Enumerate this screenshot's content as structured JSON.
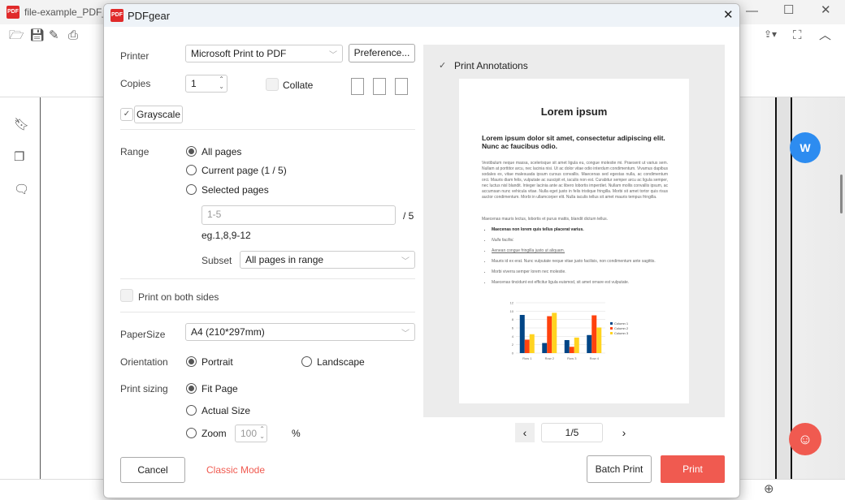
{
  "app": {
    "title": "file-example_PDF_",
    "window_controls": [
      "minimize",
      "maximize",
      "close"
    ]
  },
  "dialog": {
    "title": "PDFgear",
    "printer": {
      "label": "Printer",
      "value": "Microsoft Print to PDF",
      "preferences_label": "Preference..."
    },
    "copies": {
      "label": "Copies",
      "value": "1",
      "collate_label": "Collate",
      "collate_checked": false
    },
    "grayscale": {
      "label": "Grayscale",
      "checked": true
    },
    "range": {
      "label": "Range",
      "options": [
        "All pages",
        "Current page (1 / 5)",
        "Selected pages"
      ],
      "selected": 0,
      "pages_value": "1-5",
      "total": "/ 5",
      "hint": "eg.1,8,9-12",
      "subset_label": "Subset",
      "subset_value": "All pages in range"
    },
    "both_sides": {
      "label": "Print on both sides",
      "checked": false
    },
    "paper": {
      "label": "PaperSize",
      "value": "A4 (210*297mm)"
    },
    "orientation": {
      "label": "Orientation",
      "options": [
        "Portrait",
        "Landscape"
      ],
      "selected": 0
    },
    "sizing": {
      "label": "Print sizing",
      "options": [
        "Fit Page",
        "Actual Size",
        "Zoom"
      ],
      "selected": 0,
      "zoom_value": "100",
      "zoom_unit": "%"
    },
    "buttons": {
      "cancel": "Cancel",
      "classic": "Classic Mode",
      "batch": "Batch Print",
      "print": "Print"
    },
    "preview": {
      "annotations_label": "Print Annotations",
      "annotations_checked": true,
      "page_indicator": "1/5",
      "doc": {
        "title": "Lorem ipsum",
        "subtitle": "Lorem ipsum dolor sit amet, consectetur adipiscing elit. Nunc ac faucibus odio.",
        "para1": "Vestibulum neque massa, scelerisque sit amet ligula eu, congue molestie mi. Praesent ut varius sem. Nullam at porttitor arcu, nec lacinia nisi. Ut ac dolor vitae odio interdum condimentum. Vivamus dapibus sodales ex, vitae malesuada ipsum cursus convallis. Maecenas sed egestas nulla, ac condimentum orci. Mauris diam felis, vulputate ac suscipit et, iaculis non est. Curabitur semper arcu ac ligula semper, nec luctus nisl blandit. Integer lacinia ante ac libero lobortis imperdiet. Nullam mollis convallis ipsum, ac accumsan nunc vehicula vitae. Nulla eget justo in felis tristique fringilla. Morbi sit amet tortor quis risus auctor condimentum. Morbi in ullamcorper elit. Nulla iaculis tellus sit amet mauris tempus fringilla.",
        "para2": "Maecenas mauris lectus, lobortis et purus mattis, blandit dictum tellus.",
        "bullets": [
          "Maecenas non lorem quis tellus placerat varius.",
          "Nulla facilisi.",
          "Aenean congue fringilla justo ut aliquam.",
          "Mauris id ex erat. Nunc vulputate neque vitae justo facilisis, non condimentum ante sagittis.",
          "Morbi viverra semper lorem nec molestie.",
          "Maecenas tincidunt est efficitur ligula euismod, sit amet ornare est vulputate."
        ],
        "chart": {
          "type": "bar",
          "categories": [
            "Row 1",
            "Row 2",
            "Row 3",
            "Row 4"
          ],
          "ylim": [
            0,
            12
          ],
          "yticks": [
            "0",
            "2",
            "4",
            "6",
            "8",
            "10",
            "12"
          ],
          "series": [
            {
              "name": "Column 1",
              "color": "#004586",
              "values": [
                9.1,
                2.4,
                3.1,
                4.3
              ]
            },
            {
              "name": "Column 2",
              "color": "#ff420e",
              "values": [
                3.2,
                8.8,
                1.5,
                9
              ]
            },
            {
              "name": "Column 3",
              "color": "#ffd320",
              "values": [
                4.5,
                9.6,
                3.7,
                6.1
              ]
            }
          ]
        }
      }
    }
  }
}
